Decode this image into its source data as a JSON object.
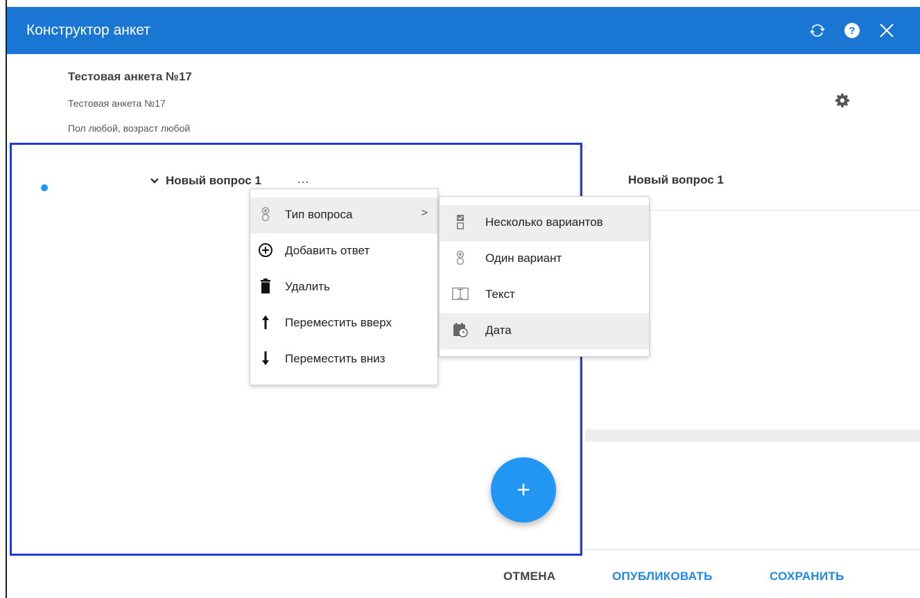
{
  "window": {
    "title": "Конструктор анкет",
    "icons": {
      "refresh": "refresh-icon",
      "help": "help-icon",
      "close": "close-icon"
    }
  },
  "survey": {
    "title": "Тестовая анкета №17",
    "description": "Тестовая анкета №17",
    "audience": "Пол любой, возраст любой"
  },
  "questions": [
    {
      "label": "Новый вопрос 1",
      "more": "..."
    }
  ],
  "context_menu": {
    "items": [
      {
        "label": "Тип вопроса",
        "icon": "radio-type-icon",
        "arrow": ">"
      },
      {
        "label": "Добавить ответ",
        "icon": "add-circle-icon"
      },
      {
        "label": "Удалить",
        "icon": "trash-icon"
      },
      {
        "label": "Переместить вверх",
        "icon": "arrow-up-icon"
      },
      {
        "label": "Переместить вниз",
        "icon": "arrow-down-icon"
      }
    ]
  },
  "type_submenu": {
    "items": [
      {
        "label": "Несколько вариантов",
        "icon": "checkbox-icon"
      },
      {
        "label": "Один вариант",
        "icon": "radio-icon"
      },
      {
        "label": "Текст",
        "icon": "text-icon"
      },
      {
        "label": "Дата",
        "icon": "calendar-icon"
      }
    ]
  },
  "detail": {
    "title": "Новый вопрос 1"
  },
  "fab": {
    "label": "+"
  },
  "footer": {
    "cancel": "ОТМЕНА",
    "publish": "ОПУБЛИКОВАТЬ",
    "save": "СОХРАНИТЬ"
  },
  "colors": {
    "primary": "#1976d2",
    "accent": "#2196f3",
    "selection_border": "#1f3bdc"
  }
}
